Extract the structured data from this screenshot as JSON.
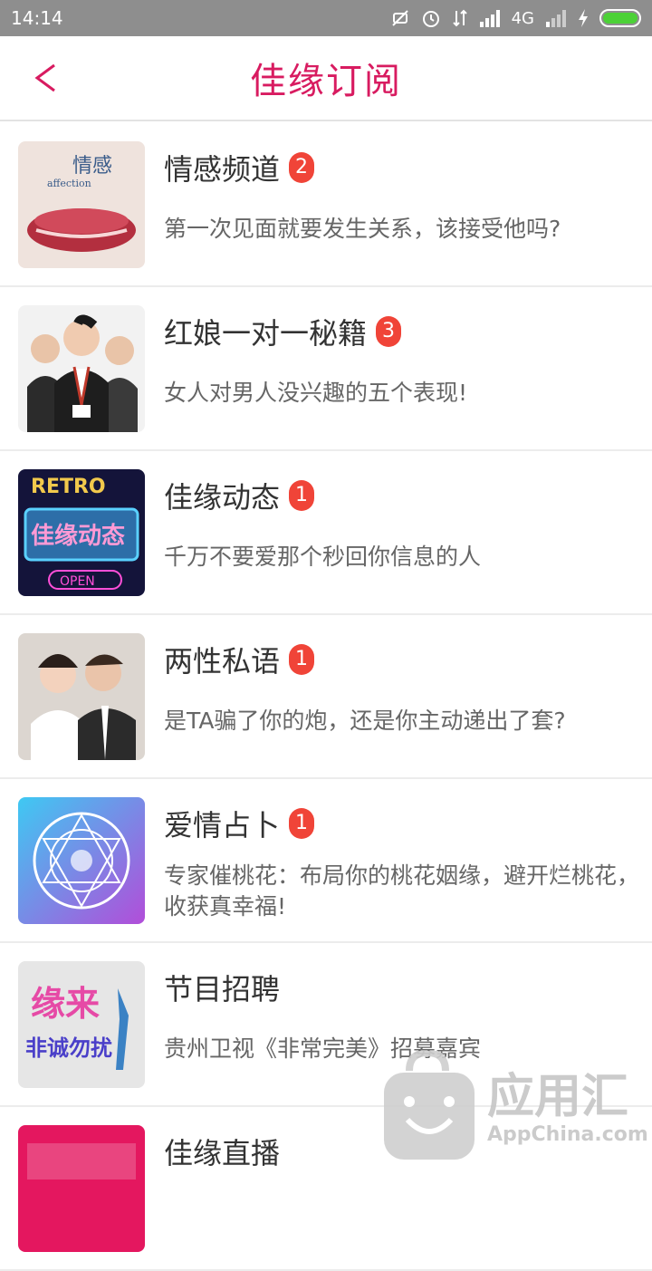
{
  "status": {
    "time": "14:14",
    "network": "4G"
  },
  "header": {
    "title": "佳缘订阅",
    "back_icon": "chevron-left-icon"
  },
  "colors": {
    "accent": "#d81b60",
    "badge": "#f04438",
    "status_bar": "#8e8e8e"
  },
  "items": [
    {
      "title": "情感频道",
      "badge": "2",
      "subtitle": "第一次见面就要发生关系，该接受他吗?"
    },
    {
      "title": "红娘一对一秘籍",
      "badge": "3",
      "subtitle": "女人对男人没兴趣的五个表现!"
    },
    {
      "title": "佳缘动态",
      "badge": "1",
      "subtitle": "千万不要爱那个秒回你信息的人"
    },
    {
      "title": "两性私语",
      "badge": "1",
      "subtitle": "是TA骗了你的炮，还是你主动递出了套?"
    },
    {
      "title": "爱情占卜",
      "badge": "1",
      "subtitle": "专家催桃花：布局你的桃花姻缘，避开烂桃花，收获真幸福!"
    },
    {
      "title": "节目招聘",
      "subtitle": "贵州卫视《非常完美》招募嘉宾"
    },
    {
      "title": "佳缘直播"
    }
  ],
  "thumb_text": {
    "t1_line1": "情感",
    "t1_line2": "affection",
    "t3_top": "RETRO",
    "t3_mid": "佳缘动态",
    "t3_bottom": "OPEN",
    "t6_line1": "缘来",
    "t6_line2": "非诚勿扰"
  },
  "watermark": {
    "title": "应用汇",
    "sub": "AppChina.com"
  }
}
